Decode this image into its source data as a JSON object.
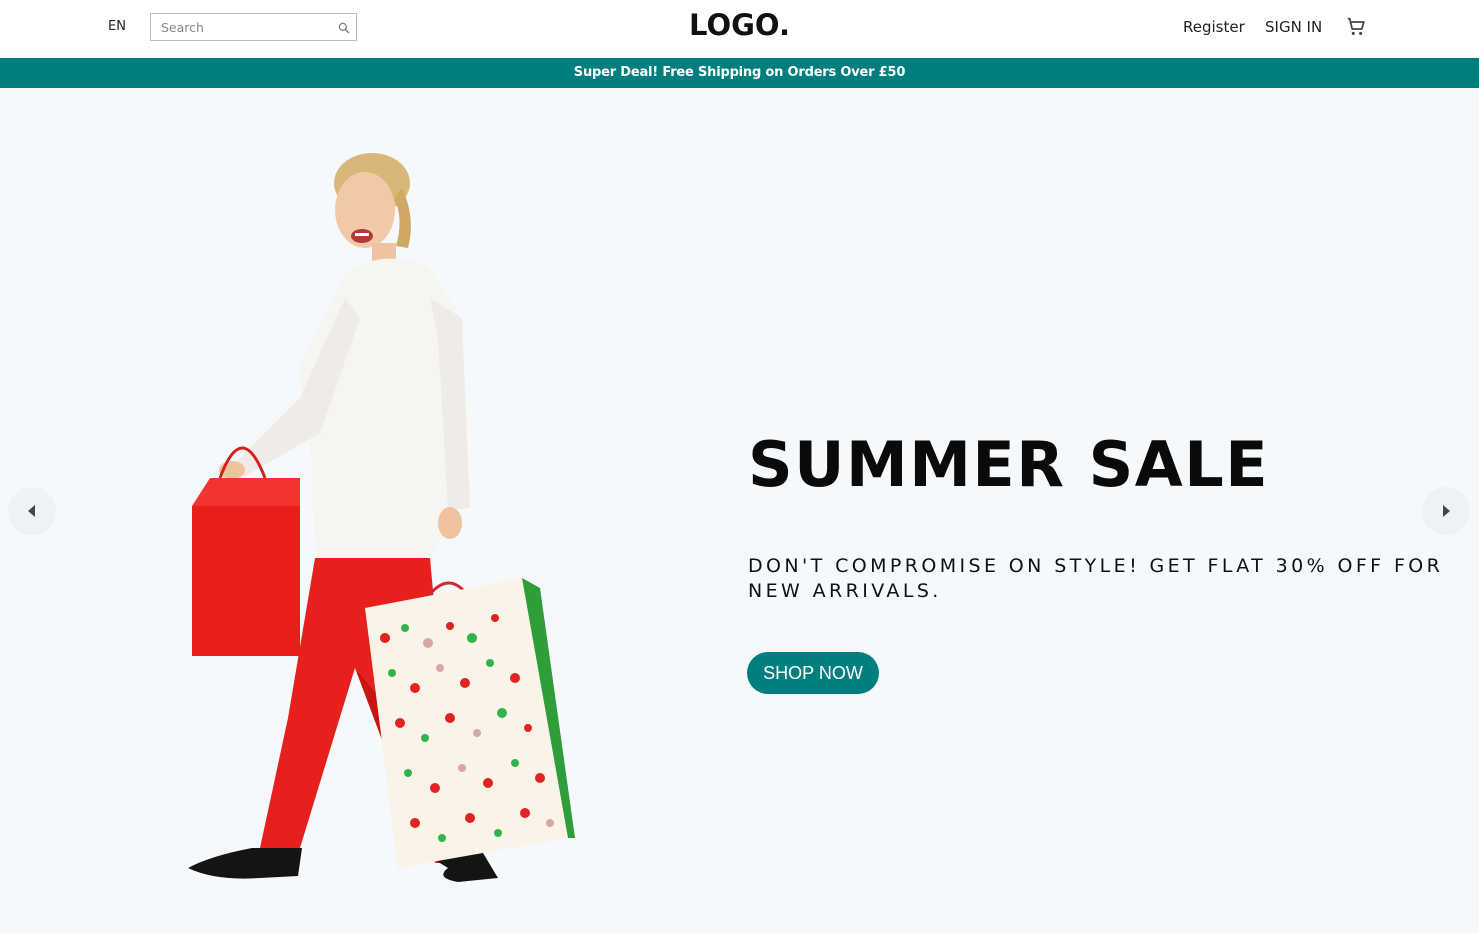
{
  "header": {
    "language": "EN",
    "search": {
      "placeholder": "Search",
      "value": ""
    },
    "logo": "LOGO.",
    "register_label": "Register",
    "signin_label": "SIGN IN",
    "cart_icon": "shopping-cart-icon"
  },
  "announcement": {
    "text": "Super Deal! Free Shipping on Orders Over £50"
  },
  "slider": {
    "title": "SUMMER SALE",
    "description": "DON'T COMPROMISE ON STYLE! GET FLAT 30% OFF FOR NEW ARRIVALS.",
    "button_label": "SHOP NOW",
    "prev_icon": "arrow-left-icon",
    "next_icon": "arrow-right-icon"
  },
  "colors": {
    "accent": "#017f7f",
    "slide_background": "#f5f9fb",
    "header_background": "#ffffff"
  }
}
